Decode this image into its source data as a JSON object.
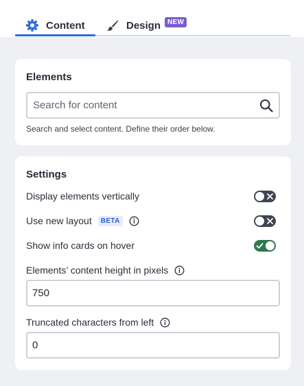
{
  "tabs": {
    "content": {
      "label": "Content",
      "icon": "gear-icon",
      "active": true
    },
    "design": {
      "label": "Design",
      "icon": "paintbrush-icon",
      "badge": "NEW"
    }
  },
  "elements_card": {
    "title": "Elements",
    "search": {
      "placeholder": "Search for content",
      "value": ""
    },
    "help_text": "Search and select content. Define their order below."
  },
  "settings_card": {
    "title": "Settings",
    "vertical": {
      "label": "Display elements vertically",
      "enabled": false
    },
    "new_layout": {
      "label": "Use new layout",
      "badge": "BETA",
      "enabled": false
    },
    "info_cards": {
      "label": "Show info cards on hover",
      "enabled": true
    },
    "content_height": {
      "label": "Elements’ content height in pixels",
      "value": "750"
    },
    "truncated": {
      "label": "Truncated characters from left",
      "value": "0"
    }
  },
  "colors": {
    "accent": "#2f6bdc",
    "toggle_on": "#2e7a4f",
    "toggle_off": "#3f4552",
    "new_badge": "#7b5ccf",
    "beta_badge_bg": "#e4ecfb"
  }
}
